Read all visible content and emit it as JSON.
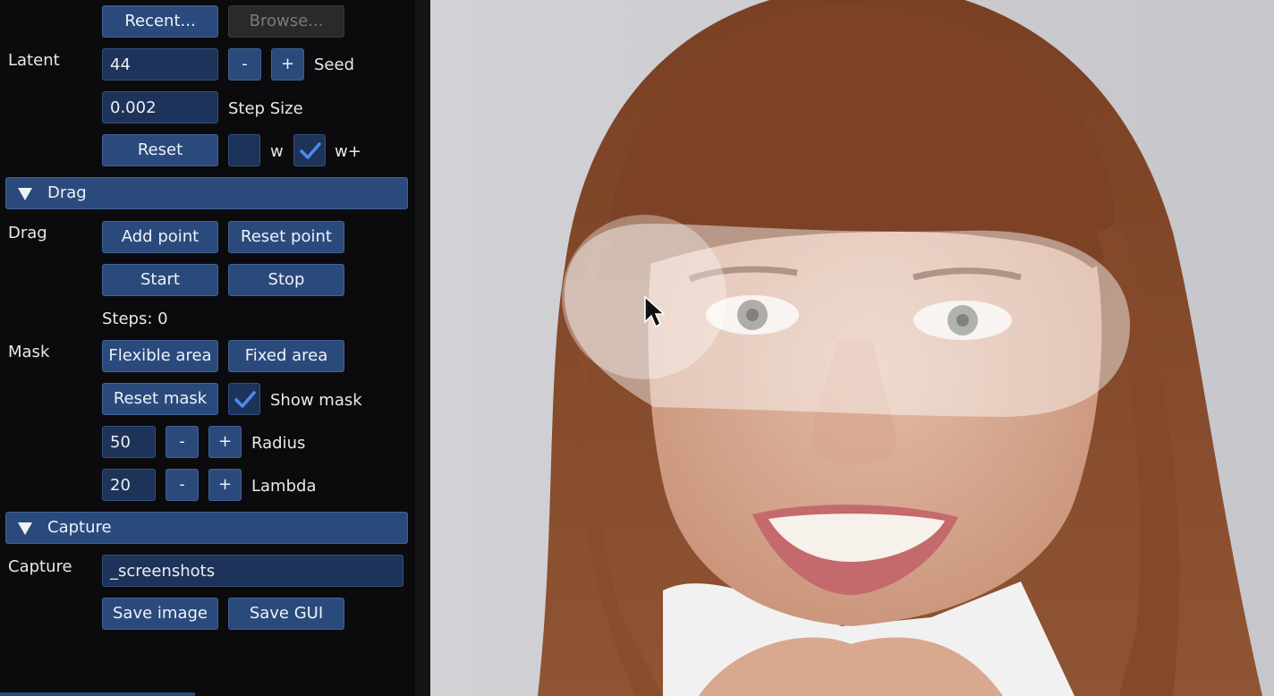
{
  "top": {
    "recent_label": "Recent...",
    "browse_label": "Browse..."
  },
  "latent": {
    "section_label": "Latent",
    "seed_value": "44",
    "minus_label": "-",
    "plus_label": "+",
    "seed_label": "Seed",
    "step_size_value": "0.002",
    "step_size_label": "Step Size",
    "reset_label": "Reset",
    "w_label": "w",
    "w_checked": false,
    "wplus_label": "w+",
    "wplus_checked": true
  },
  "drag_header": {
    "title": "Drag"
  },
  "drag": {
    "section_label": "Drag",
    "add_point_label": "Add point",
    "reset_point_label": "Reset point",
    "start_label": "Start",
    "stop_label": "Stop",
    "steps_text": "Steps: 0"
  },
  "mask": {
    "section_label": "Mask",
    "flexible_label": "Flexible area",
    "fixed_label": "Fixed area",
    "reset_mask_label": "Reset mask",
    "show_mask_label": "Show mask",
    "show_mask_checked": true,
    "radius_value": "50",
    "radius_label": "Radius",
    "lambda_value": "20",
    "lambda_label": "Lambda",
    "minus_label": "-",
    "plus_label": "+"
  },
  "capture_header": {
    "title": "Capture"
  },
  "capture": {
    "section_label": "Capture",
    "dir_value": "_screenshots",
    "save_image_label": "Save image",
    "save_gui_label": "Save GUI"
  },
  "colors": {
    "button": "#2b4a7c",
    "field": "#1e3359",
    "check": "#4a8cf0",
    "panel_bg": "#0b0b0d"
  }
}
